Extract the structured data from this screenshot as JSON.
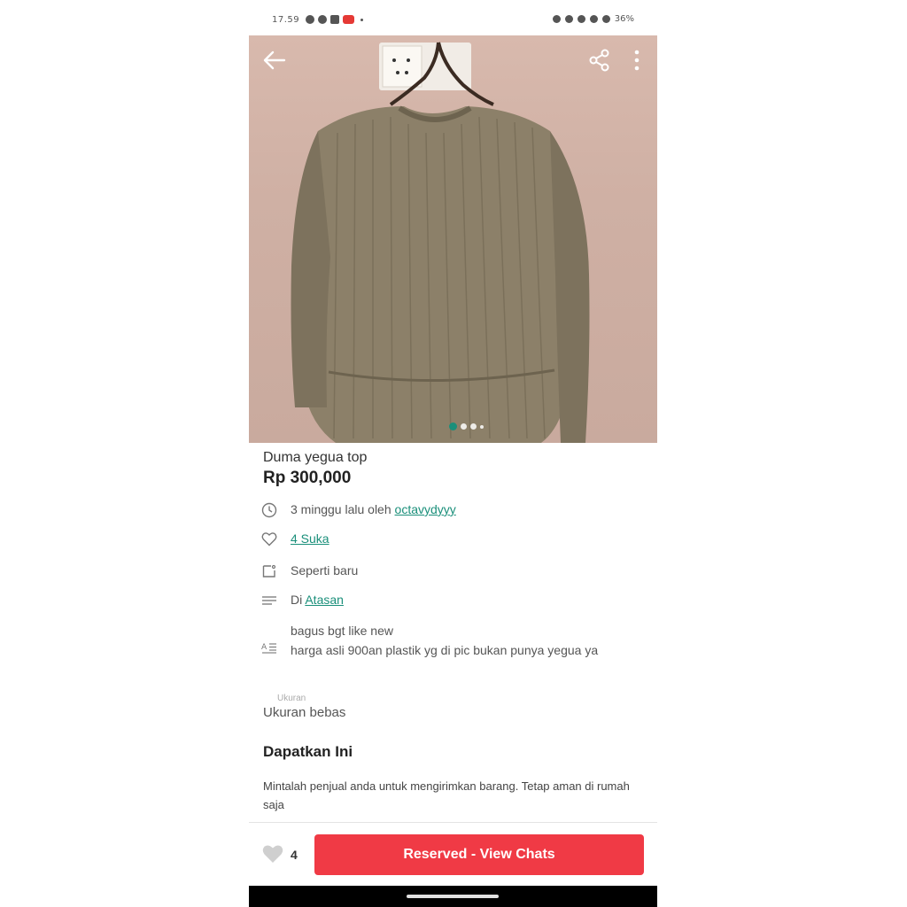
{
  "status_bar": {
    "time": "17.59",
    "battery": "36%"
  },
  "product": {
    "title": "Duma yegua top",
    "price": "Rp 300,000",
    "image_dots": 4,
    "active_dot": 1
  },
  "details": {
    "posted": {
      "prefix": "3 minggu lalu oleh ",
      "seller": "octavydyyy",
      "icon": "clock-icon"
    },
    "likes": {
      "label": "4 Suka",
      "icon": "heart-outline-icon"
    },
    "condition": {
      "label": "Seperti baru",
      "icon": "tag-icon"
    },
    "category": {
      "prefix": "Di ",
      "link": "Atasan",
      "icon": "list-icon"
    },
    "description": {
      "line1": "bagus bgt like new",
      "line2": "harga asli 900an plastik yg di pic bukan punya yegua ya",
      "icon": "text-format-icon"
    }
  },
  "size": {
    "label": "Ukuran",
    "value": "Ukuran bebas"
  },
  "get_it": {
    "title": "Dapatkan Ini",
    "text": "Mintalah penjual anda untuk mengirimkan barang. Tetap aman di rumah saja"
  },
  "bottom_bar": {
    "like_count": "4",
    "cta_label": "Reserved - View Chats"
  },
  "colors": {
    "accent": "#1a8f7a",
    "cta": "#f03a45"
  }
}
